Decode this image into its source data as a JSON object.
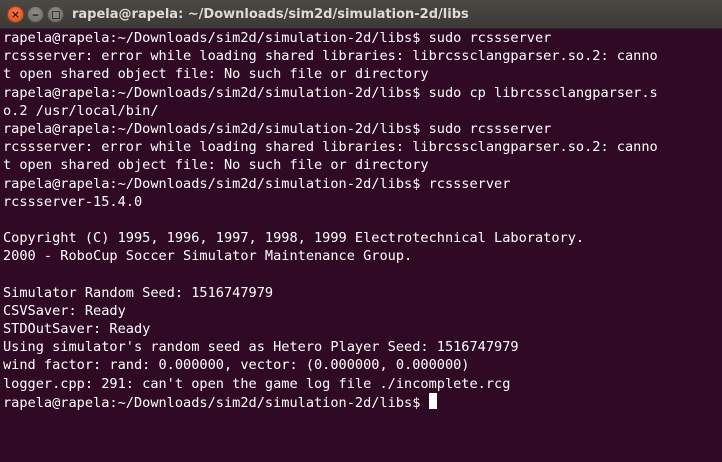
{
  "window": {
    "title": "rapela@rapela: ~/Downloads/sim2d/simulation-2d/libs",
    "close_glyph": "×",
    "minimize_glyph": "–"
  },
  "terminal": {
    "lines": [
      "rapela@rapela:~/Downloads/sim2d/simulation-2d/libs$ sudo rcssserver",
      "rcssserver: error while loading shared libraries: librcssclangparser.so.2: canno",
      "t open shared object file: No such file or directory",
      "rapela@rapela:~/Downloads/sim2d/simulation-2d/libs$ sudo cp librcssclangparser.s",
      "o.2 /usr/local/bin/",
      "rapela@rapela:~/Downloads/sim2d/simulation-2d/libs$ sudo rcssserver",
      "rcssserver: error while loading shared libraries: librcssclangparser.so.2: canno",
      "t open shared object file: No such file or directory",
      "rapela@rapela:~/Downloads/sim2d/simulation-2d/libs$ rcssserver",
      "rcssserver-15.4.0",
      "",
      "Copyright (C) 1995, 1996, 1997, 1998, 1999 Electrotechnical Laboratory.",
      "2000 - RoboCup Soccer Simulator Maintenance Group.",
      "",
      "Simulator Random Seed: 1516747979",
      "CSVSaver: Ready",
      "STDOutSaver: Ready",
      "Using simulator's random seed as Hetero Player Seed: 1516747979",
      "wind factor: rand: 0.000000, vector: (0.000000, 0.000000)",
      "logger.cpp: 291: can't open the game log file ./incomplete.rcg"
    ],
    "prompt": "rapela@rapela:~/Downloads/sim2d/simulation-2d/libs$ "
  },
  "colors": {
    "background": "#300a24",
    "text": "#ffffff",
    "titlebar": "#3c3b37",
    "title_text": "#dfdbd2",
    "close_button": "#e95420"
  }
}
